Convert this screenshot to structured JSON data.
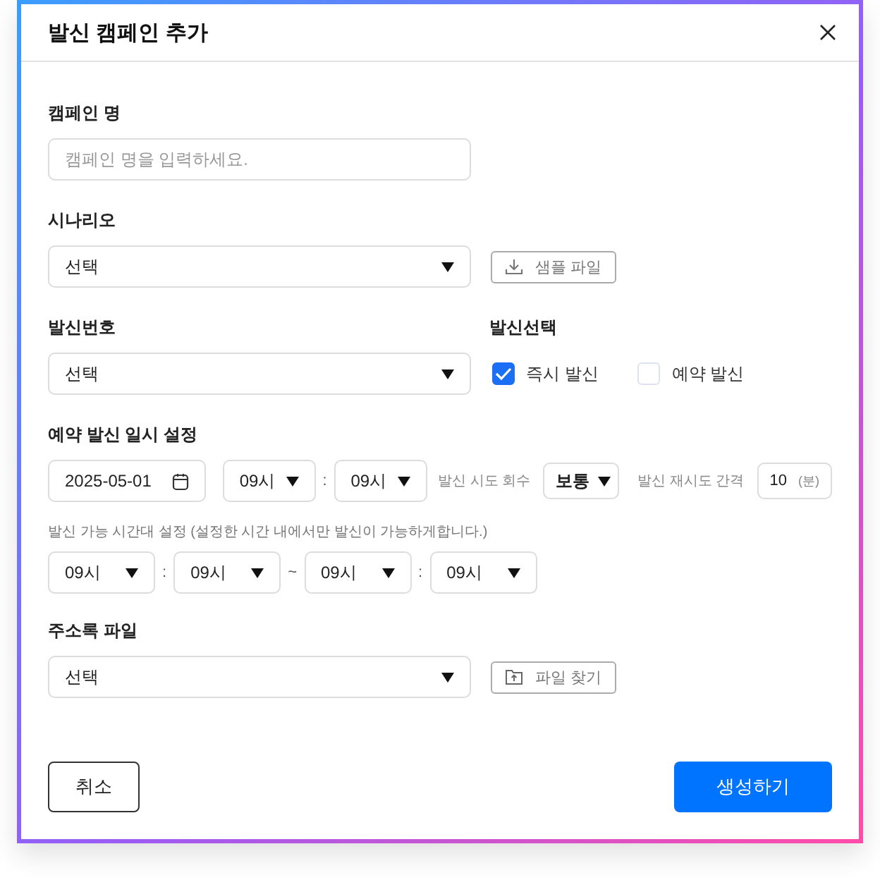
{
  "dialog": {
    "title": "발신 캠페인 추가"
  },
  "campaign_name": {
    "label": "캠페인 명",
    "placeholder": "캠페인 명을 입력하세요."
  },
  "scenario": {
    "label": "시나리오",
    "value": "선택",
    "button": "샘플 파일"
  },
  "sender_number": {
    "label": "발신번호",
    "value": "선택"
  },
  "send_mode": {
    "label": "발신선택",
    "options": [
      {
        "label": "즉시 발신",
        "checked": true
      },
      {
        "label": "예약 발신",
        "checked": false
      }
    ]
  },
  "schedule": {
    "label": "예약 발신 일시 설정",
    "date": "2025-05-01",
    "items": [
      {
        "kind": "select",
        "value": "09시"
      },
      {
        "kind": "separator",
        "text": ":"
      },
      {
        "kind": "select",
        "value": "09시"
      }
    ],
    "attempts_label": "발신 시도 회수",
    "attempts": "보통",
    "retry_label": "발신 재시도 간격",
    "retry_value": "10",
    "retry_unit": "(분)"
  },
  "time_window": {
    "label": "발신 가능 시간대 설정 (설정한 시간 내에서만 발신이 가능하게합니다.)",
    "items": [
      {
        "kind": "select",
        "value": "09시"
      },
      {
        "kind": "separator",
        "text": ":"
      },
      {
        "kind": "select",
        "value": "09시"
      },
      {
        "kind": "separator",
        "text": "~"
      },
      {
        "kind": "select",
        "value": "09시"
      },
      {
        "kind": "separator",
        "text": ":"
      },
      {
        "kind": "select",
        "value": "09시"
      }
    ]
  },
  "address_book": {
    "label": "주소록 파일",
    "value": "선택",
    "button": "파일 찾기"
  },
  "buttons": [
    {
      "label": "취소",
      "kind": "secondary"
    },
    {
      "label": "생성하기",
      "kind": "primary"
    }
  ]
}
